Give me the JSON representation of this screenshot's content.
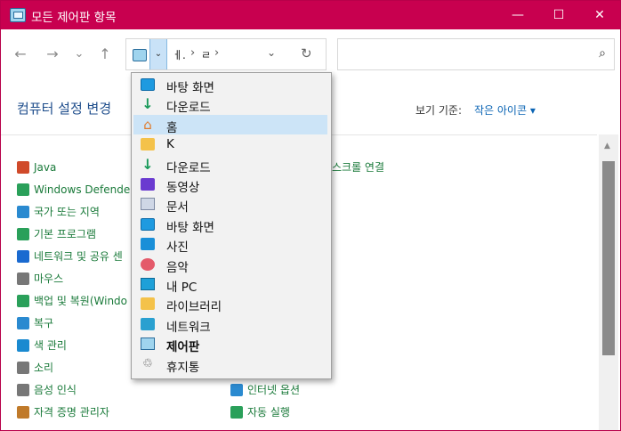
{
  "window": {
    "title": "모든 제어판 항목",
    "buttons": {
      "minimize": "—",
      "maximize": "☐",
      "close": "✕"
    }
  },
  "navbar": {
    "back_icon": "←",
    "forward_icon": "→",
    "history_icon": "⌄",
    "up_icon": "↑",
    "address": {
      "crumb_icon_glyph": "⌄",
      "crumb1": "ㅔ.",
      "crumb2": "ㄹ",
      "sep_glyph": "›",
      "dropdown_glyph": "⌄",
      "refresh_glyph": "↻"
    },
    "search": {
      "placeholder": "",
      "icon_glyph": "⌕"
    }
  },
  "content": {
    "page_title": "컴퓨터 설정 변경",
    "view_by_label": "보기 기준:",
    "view_by_value": "작은 아이콘 ▾",
    "left_column": [
      {
        "label": "Java",
        "icon": "java-icon",
        "color": "#d04a2a"
      },
      {
        "label": "Windows Defender",
        "icon": "windows-defender-icon",
        "color": "#2aa05a"
      },
      {
        "label": "국가 또는 지역",
        "icon": "globe-icon",
        "color": "#2a8ad0"
      },
      {
        "label": "기본 프로그램",
        "icon": "default-programs-icon",
        "color": "#2aa05a"
      },
      {
        "label": "네트워크 및 공유 센",
        "icon": "network-icon",
        "color": "#1a6ad0"
      },
      {
        "label": "마우스",
        "icon": "mouse-icon",
        "color": "#777777"
      },
      {
        "label": "백업 및 복원(Windo",
        "icon": "backup-icon",
        "color": "#2aa05a"
      },
      {
        "label": "복구",
        "icon": "recovery-icon",
        "color": "#2a8ad0"
      },
      {
        "label": "색 관리",
        "icon": "color-management-icon",
        "color": "#1a8ad0"
      },
      {
        "label": "소리",
        "icon": "speaker-icon",
        "color": "#777777"
      },
      {
        "label": "음성 인식",
        "icon": "microphone-icon",
        "color": "#777777"
      },
      {
        "label": "자격 증명 관리자",
        "icon": "credential-icon",
        "color": "#c07a2a"
      }
    ],
    "right_column": [
      {
        "label": "스크롤 연결",
        "icon": "",
        "color": "#1a7a3a"
      },
      {
        "label": "인터넷 옵션",
        "icon": "internet-options-icon",
        "color": "#2a8ad0"
      },
      {
        "label": "자동 실행",
        "icon": "autoplay-icon",
        "color": "#2aa05a"
      }
    ]
  },
  "dropdown_menu": {
    "items": [
      {
        "label": "바탕 화면",
        "icon": "desktop-icon",
        "highlight": false,
        "bold": false
      },
      {
        "label": "다운로드",
        "icon": "download-icon",
        "highlight": false,
        "bold": false
      },
      {
        "label": "홈",
        "icon": "home-icon",
        "highlight": true,
        "bold": false
      },
      {
        "label": "K",
        "icon": "folder-icon",
        "highlight": false,
        "bold": false
      },
      {
        "label": "다운로드",
        "icon": "download-icon",
        "highlight": false,
        "bold": false
      },
      {
        "label": "동영상",
        "icon": "video-icon",
        "highlight": false,
        "bold": false
      },
      {
        "label": "문서",
        "icon": "document-icon",
        "highlight": false,
        "bold": false
      },
      {
        "label": "바탕 화면",
        "icon": "desktop-icon",
        "highlight": false,
        "bold": false
      },
      {
        "label": "사진",
        "icon": "pictures-icon",
        "highlight": false,
        "bold": false
      },
      {
        "label": "음악",
        "icon": "music-icon",
        "highlight": false,
        "bold": false
      },
      {
        "label": "내 PC",
        "icon": "pc-icon",
        "highlight": false,
        "bold": false
      },
      {
        "label": "라이브러리",
        "icon": "library-icon",
        "highlight": false,
        "bold": false
      },
      {
        "label": "네트워크",
        "icon": "network-icon",
        "highlight": false,
        "bold": false
      },
      {
        "label": "제어판",
        "icon": "control-panel-icon",
        "highlight": false,
        "bold": true
      },
      {
        "label": "휴지통",
        "icon": "recycle-bin-icon",
        "highlight": false,
        "bold": false
      }
    ],
    "icon_glyphs": {
      "download": "↓",
      "home": "⌂",
      "bin": "♲"
    }
  },
  "colors": {
    "titlebar": "#c8004f",
    "link": "#1a7a3a",
    "title_text": "#1f4e8c",
    "menu_highlight": "#cce4f7"
  }
}
